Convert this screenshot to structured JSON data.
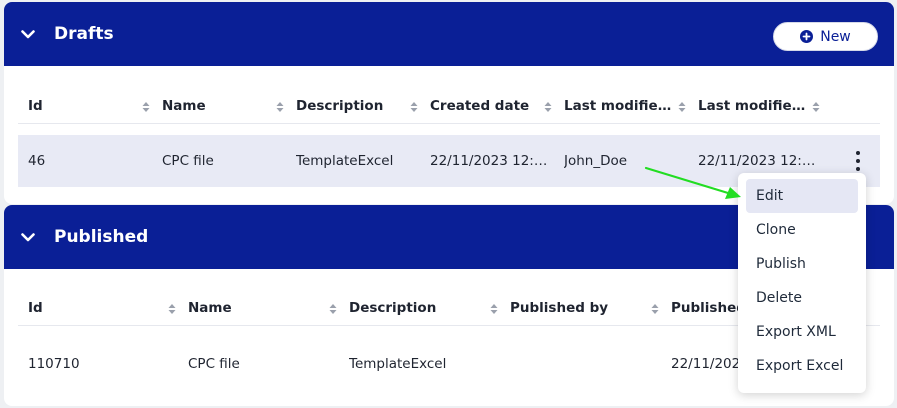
{
  "drafts": {
    "title": "Drafts",
    "new_button_label": "New",
    "columns": [
      "Id",
      "Name",
      "Description",
      "Created date",
      "Last modified…",
      "Last modified…"
    ],
    "rows": [
      {
        "id": "46",
        "name": "CPC file",
        "description": "TemplateExcel",
        "created": "22/11/2023 12:…",
        "modified_by": "John_Doe",
        "modified_date": "22/11/2023 12:…"
      }
    ]
  },
  "published": {
    "title": "Published",
    "columns": [
      "Id",
      "Name",
      "Description",
      "Published by",
      "Published"
    ],
    "rows": [
      {
        "id": "110710",
        "name": "CPC file",
        "description": "TemplateExcel",
        "published_by": "",
        "published_date": "22/11/2023"
      }
    ]
  },
  "context_menu": {
    "items": [
      "Edit",
      "Clone",
      "Publish",
      "Delete",
      "Export XML",
      "Export Excel"
    ],
    "active_item": "Edit"
  },
  "colors": {
    "header_blue": "#0a1f96",
    "row_highlight": "#e8eaf5",
    "annotation_arrow": "#22dd22"
  },
  "icons": {
    "collapse": "chevron-down-icon",
    "new": "plus-circle-icon",
    "sort": "sort-icon",
    "row_menu": "more-vertical-icon"
  }
}
